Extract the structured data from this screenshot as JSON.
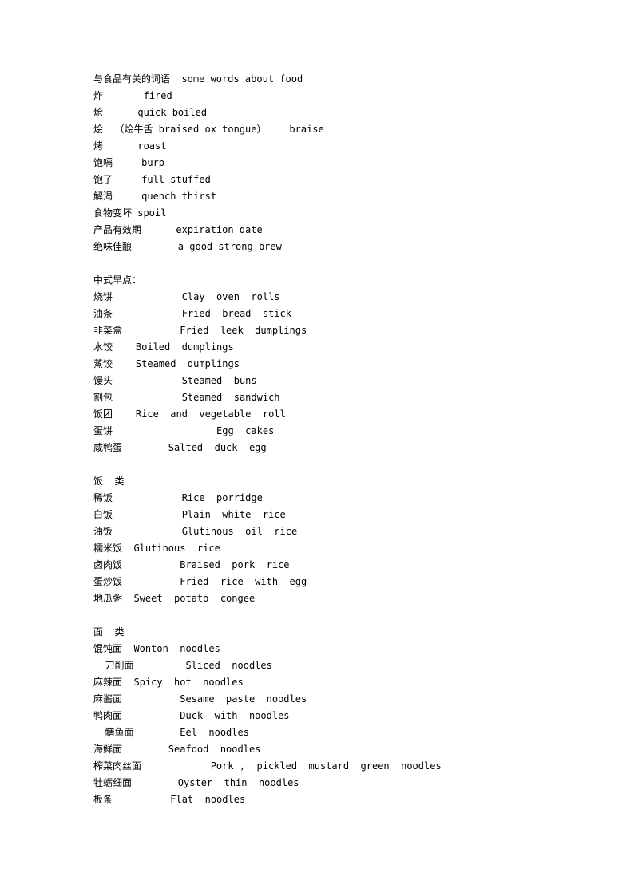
{
  "document": {
    "background_color": "#ffffff",
    "text_color": "#000000",
    "sections": [
      {
        "name": "food-words",
        "heading": "与食品有关的词语  some words about food",
        "lines": [
          "与食品有关的词语  some words about food",
          "炸       fired",
          "炝      quick boiled",
          "烩  （烩牛舌 braised ox tongue）    braise",
          "烤      roast",
          "饱嗝     burp",
          "饱了     full stuffed",
          "解渴     quench thirst",
          "食物变坏 spoil",
          "产品有效期      expiration date",
          "绝味佳酿        a good strong brew"
        ]
      },
      {
        "name": "chinese-breakfast",
        "heading": "中式早点：",
        "lines": [
          "中式早点：",
          "烧饼            Clay  oven  rolls",
          "油条            Fried  bread  stick",
          "韭菜盒          Fried  leek  dumplings",
          "水饺    Boiled  dumplings",
          "蒸饺    Steamed  dumplings",
          "馒头            Steamed  buns",
          "割包            Steamed  sandwich",
          "饭团    Rice  and  vegetable  roll",
          "蛋饼                  Egg  cakes",
          "咸鸭蛋        Salted  duck  egg"
        ]
      },
      {
        "name": "rice-category",
        "heading": "饭  类",
        "lines": [
          "饭  类",
          "稀饭            Rice  porridge",
          "白饭            Plain  white  rice",
          "油饭            Glutinous  oil  rice",
          "糯米饭  Glutinous  rice",
          "卤肉饭          Braised  pork  rice",
          "蛋炒饭          Fried  rice  with  egg",
          "地瓜粥  Sweet  potato  congee"
        ]
      },
      {
        "name": "noodles-category",
        "heading": "面  类",
        "lines": [
          "面  类",
          "馄饨面  Wonton  noodles",
          "  刀削面         Sliced  noodles",
          "麻辣面  Spicy  hot  noodles",
          "麻酱面          Sesame  paste  noodles",
          "鸭肉面          Duck  with  noodles",
          "  鳝鱼面        Eel  noodles",
          "海鲜面        Seafood  noodles",
          "榨菜肉丝面            Pork ,  pickled  mustard  green  noodles",
          "牡蛎细面        Oyster  thin  noodles",
          "板条          Flat  noodles"
        ]
      }
    ]
  }
}
